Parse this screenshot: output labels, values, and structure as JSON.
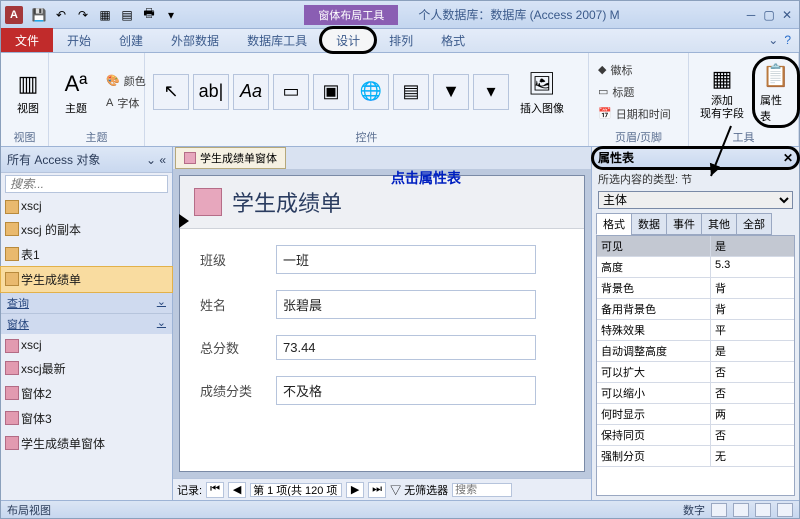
{
  "titlebar": {
    "context_label": "窗体布局工具",
    "title": "个人数据库：数据库 (Access 2007) M"
  },
  "tabs": {
    "file": "文件",
    "items": [
      "开始",
      "创建",
      "外部数据",
      "数据库工具",
      "设计",
      "排列",
      "格式"
    ]
  },
  "ribbon": {
    "view_group": "视图",
    "view_btn": "视图",
    "theme_group": "主题",
    "theme_btn": "主题",
    "colors": "颜色",
    "fonts": "字体",
    "controls_group": "控件",
    "insert_image": "插入图像",
    "hf_group": "页眉/页脚",
    "logo": "徽标",
    "title_btn": "标题",
    "datetime": "日期和时间",
    "tools_group": "工具",
    "add_fields": "添加\n现有字段",
    "prop_sheet_btn": "属性表"
  },
  "callout": "点击属性表",
  "nav": {
    "header": "所有 Access 对象",
    "search_placeholder": "搜索...",
    "tables": [
      "xscj",
      "xscj 的副本",
      "表1",
      "学生成绩单"
    ],
    "query_hdr": "查询",
    "form_hdr": "窗体",
    "forms": [
      "xscj",
      "xscj最新",
      "窗体2",
      "窗体3",
      "学生成绩单窗体"
    ]
  },
  "form": {
    "tab_label": "学生成绩单窗体",
    "title": "学生成绩单",
    "fields": [
      {
        "label": "班级",
        "value": "一班"
      },
      {
        "label": "姓名",
        "value": "张碧晨"
      },
      {
        "label": "总分数",
        "value": "73.44"
      },
      {
        "label": "成绩分类",
        "value": "不及格"
      }
    ],
    "recnav_label": "记录:",
    "recnav_pos": "第 1 项(共 120 项",
    "nofilter": "无筛选器",
    "search": "搜索"
  },
  "prop": {
    "title": "属性表",
    "subtitle": "所选内容的类型: 节",
    "selector": "主体",
    "tabs": [
      "格式",
      "数据",
      "事件",
      "其他",
      "全部"
    ],
    "rows": [
      {
        "n": "可见",
        "v": "是"
      },
      {
        "n": "高度",
        "v": "5.3"
      },
      {
        "n": "背景色",
        "v": "背"
      },
      {
        "n": "备用背景色",
        "v": "背"
      },
      {
        "n": "特殊效果",
        "v": "平"
      },
      {
        "n": "自动调整高度",
        "v": "是"
      },
      {
        "n": "可以扩大",
        "v": "否"
      },
      {
        "n": "可以缩小",
        "v": "否"
      },
      {
        "n": "何时显示",
        "v": "两"
      },
      {
        "n": "保持同页",
        "v": "否"
      },
      {
        "n": "强制分页",
        "v": "无"
      }
    ]
  },
  "status": {
    "left": "布局视图",
    "num": "数字"
  }
}
